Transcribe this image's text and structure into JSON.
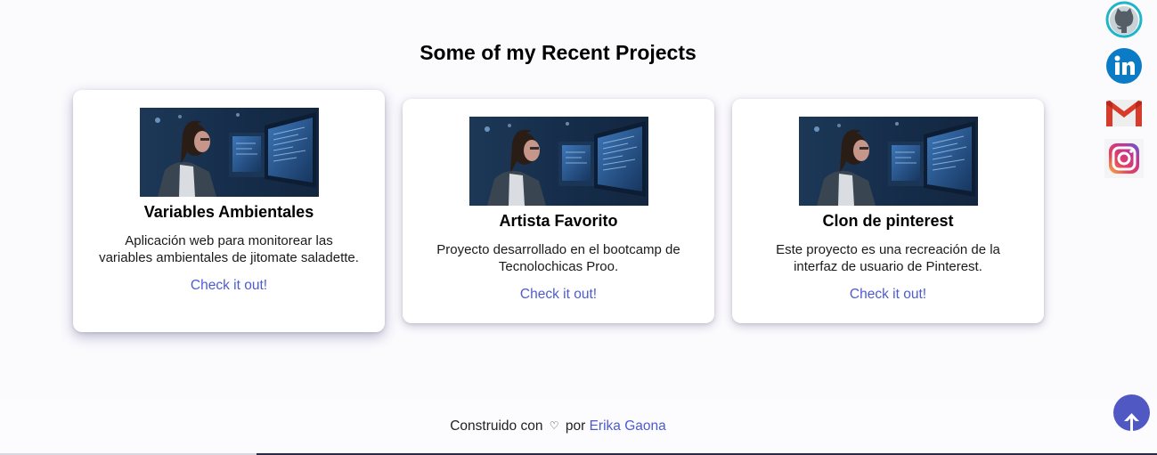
{
  "section": {
    "title": "Some of my Recent Projects"
  },
  "projects": [
    {
      "title": "Variables Ambientales",
      "description": "Aplicación web para monitorear las variables ambientales de jitomate saladette.",
      "link_label": "Check it out!",
      "image_icon": "woman-at-computers-photo"
    },
    {
      "title": "Artista Favorito",
      "description": "Proyecto desarrollado en el bootcamp de Tecnolochicas Proo.",
      "link_label": "Check it out!",
      "image_icon": "woman-at-computers-photo"
    },
    {
      "title": "Clon de pinterest",
      "description": "Este proyecto es una recreación de la interfaz de usuario de Pinterest.",
      "link_label": "Check it out!",
      "image_icon": "woman-at-computers-photo"
    }
  ],
  "social": [
    {
      "icon": "github-icon",
      "color": "#1fb6c9"
    },
    {
      "icon": "linkedin-icon",
      "color": "#0a7bc4"
    },
    {
      "icon": "gmail-icon",
      "color": "#d93b2b"
    },
    {
      "icon": "instagram-icon",
      "color": "#c2358f"
    }
  ],
  "footer": {
    "prefix": "Construido con",
    "heart": "♡",
    "by": "por",
    "author": "Erika Gaona"
  },
  "scroll_top": {
    "icon": "arrow-up-icon",
    "color": "#5058c4"
  },
  "colors": {
    "link": "#4d5bd0",
    "background": "#fbfafd"
  }
}
